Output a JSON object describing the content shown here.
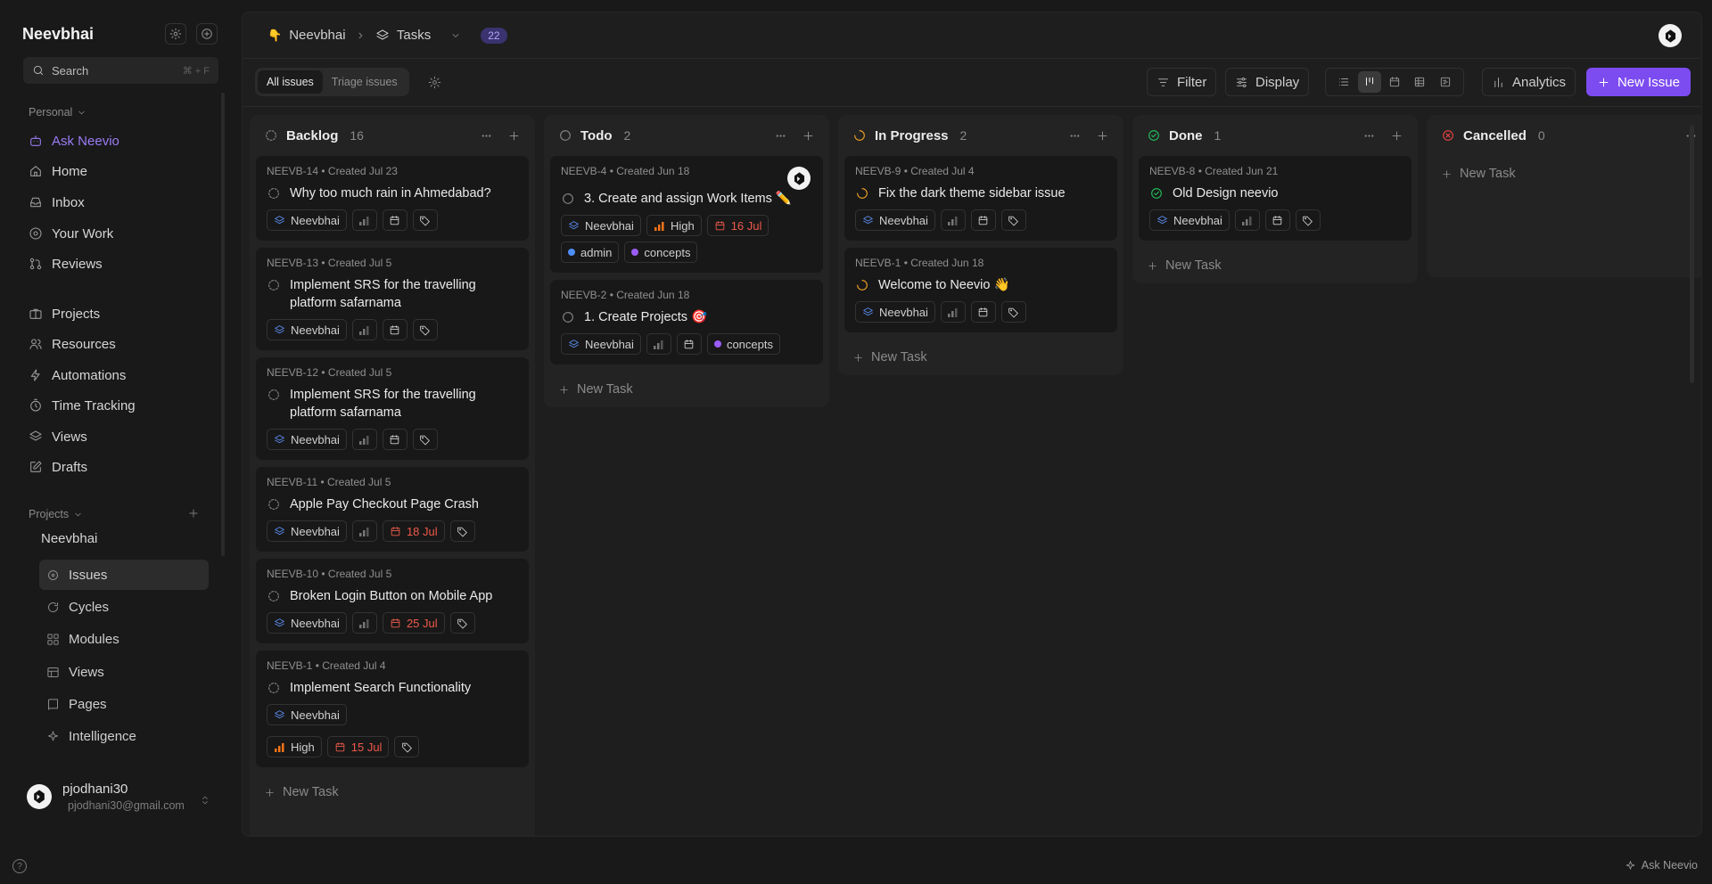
{
  "sidebar": {
    "workspace": "Neevbhai",
    "search": {
      "placeholder": "Search",
      "shortcut": "⌘ + F"
    },
    "personal_label": "Personal",
    "personal_items": [
      {
        "label": "Ask Neevio",
        "icon": "bot-icon"
      },
      {
        "label": "Home",
        "icon": "home-icon"
      },
      {
        "label": "Inbox",
        "icon": "inbox-icon"
      },
      {
        "label": "Your Work",
        "icon": "target-icon"
      },
      {
        "label": "Reviews",
        "icon": "git-pull-request-icon"
      },
      {
        "label": "Projects",
        "icon": "briefcase-icon"
      },
      {
        "label": "Resources",
        "icon": "users-icon"
      },
      {
        "label": "Automations",
        "icon": "zap-icon"
      },
      {
        "label": "Time Tracking",
        "icon": "timer-icon"
      },
      {
        "label": "Views",
        "icon": "layers-icon"
      },
      {
        "label": "Drafts",
        "icon": "pencil-square-icon"
      }
    ],
    "projects_label": "Projects",
    "project_name": "Neevbhai",
    "project_items": [
      {
        "label": "Issues",
        "icon": "issues-icon",
        "active": true
      },
      {
        "label": "Cycles",
        "icon": "cycles-icon"
      },
      {
        "label": "Modules",
        "icon": "modules-icon"
      },
      {
        "label": "Views",
        "icon": "layers-icon"
      },
      {
        "label": "Pages",
        "icon": "book-icon"
      },
      {
        "label": "Intelligence",
        "icon": "sparkle-icon"
      }
    ],
    "user": {
      "name": "pjodhani30",
      "email": "pjodhani30@gmail.com"
    }
  },
  "header": {
    "workspace": "Neevbhai",
    "section": "Tasks",
    "count": "22"
  },
  "toolbar": {
    "tabs": [
      {
        "label": "All issues",
        "active": true
      },
      {
        "label": "Triage issues",
        "active": false
      }
    ],
    "filter_label": "Filter",
    "display_label": "Display",
    "analytics_label": "Analytics",
    "new_issue_label": "New Issue"
  },
  "board": {
    "new_task_label": "New Task",
    "columns": [
      {
        "name": "Backlog",
        "count": "16",
        "status": "backlog",
        "cards": [
          {
            "id": "NEEVB-14",
            "created": "Created Jul 23",
            "title": "Why too much rain in Ahmedabad?",
            "project": "Neevbhai",
            "priority": "",
            "date": "",
            "labels": []
          },
          {
            "id": "NEEVB-13",
            "created": "Created Jul 5",
            "title": "Implement SRS for the travelling platform safarnama",
            "project": "Neevbhai",
            "priority": "",
            "date": "",
            "labels": []
          },
          {
            "id": "NEEVB-12",
            "created": "Created Jul 5",
            "title": "Implement SRS for the travelling platform safarnama",
            "project": "Neevbhai",
            "priority": "",
            "date": "",
            "labels": []
          },
          {
            "id": "NEEVB-11",
            "created": "Created Jul 5",
            "title": "Apple Pay Checkout Page Crash",
            "project": "Neevbhai",
            "priority": "",
            "date": "18 Jul",
            "labels": []
          },
          {
            "id": "NEEVB-10",
            "created": "Created Jul 5",
            "title": "Broken Login Button on Mobile App",
            "project": "Neevbhai",
            "priority": "",
            "date": "25 Jul",
            "labels": []
          },
          {
            "id": "NEEVB-1",
            "created": "Created Jul 4",
            "title": "Implement Search Functionality",
            "project": "Neevbhai",
            "priority": "High",
            "date": "15 Jul",
            "labels": []
          }
        ]
      },
      {
        "name": "Todo",
        "count": "2",
        "status": "todo",
        "cards": [
          {
            "id": "NEEVB-4",
            "created": "Created Jun 18",
            "title": "3. Create and assign Work Items ✏️",
            "project": "Neevbhai",
            "priority": "High",
            "date": "16 Jul",
            "labels": [
              {
                "name": "admin",
                "color": "#4f8ef7"
              },
              {
                "name": "concepts",
                "color": "#9b5cf6"
              }
            ],
            "avatar": true
          },
          {
            "id": "NEEVB-2",
            "created": "Created Jun 18",
            "title": "1. Create Projects 🎯",
            "project": "Neevbhai",
            "priority": "",
            "date": "",
            "labels": [
              {
                "name": "concepts",
                "color": "#9b5cf6"
              }
            ]
          }
        ]
      },
      {
        "name": "In Progress",
        "count": "2",
        "status": "progress",
        "cards": [
          {
            "id": "NEEVB-9",
            "created": "Created Jul 4",
            "title": "Fix the dark theme sidebar issue",
            "project": "Neevbhai",
            "priority": "",
            "date": "",
            "labels": []
          },
          {
            "id": "NEEVB-1",
            "created": "Created Jun 18",
            "title": "Welcome to Neevio 👋",
            "project": "Neevbhai",
            "priority": "",
            "date": "",
            "labels": []
          }
        ]
      },
      {
        "name": "Done",
        "count": "1",
        "status": "done",
        "cards": [
          {
            "id": "NEEVB-8",
            "created": "Created Jun 21",
            "title": "Old Design neevio",
            "project": "Neevbhai",
            "priority": "",
            "date": "",
            "labels": []
          }
        ]
      },
      {
        "name": "Cancelled",
        "count": "0",
        "status": "cancelled",
        "cards": []
      }
    ]
  },
  "footer": {
    "ask_label": "Ask Neevio"
  },
  "colors": {
    "accent": "#7c4cf0",
    "danger": "#ee5a4a",
    "progress": "#f5a524",
    "done": "#22c55e"
  }
}
